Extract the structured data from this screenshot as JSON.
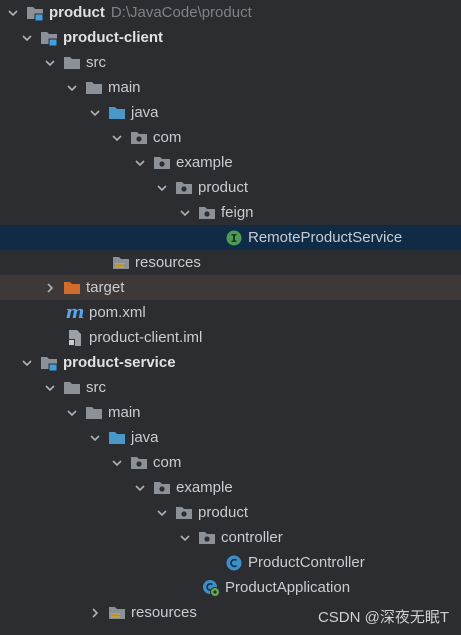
{
  "project": {
    "name": "product",
    "path": "D:\\JavaCode\\product"
  },
  "client": {
    "name": "product-client",
    "src": "src",
    "main": "main",
    "java": "java",
    "com": "com",
    "example": "example",
    "product": "product",
    "feign": "feign",
    "interface_file": "RemoteProductService",
    "resources": "resources",
    "target": "target",
    "pom": "pom.xml",
    "iml": "product-client.iml"
  },
  "service": {
    "name": "product-service",
    "src": "src",
    "main": "main",
    "java": "java",
    "com": "com",
    "example": "example",
    "product": "product",
    "controller": "controller",
    "controller_class": "ProductController",
    "app_class": "ProductApplication",
    "resources": "resources"
  },
  "watermark": "CSDN @深夜无眠T",
  "colors": {
    "background": "#2b2d30",
    "selected_row": "#0f2b46",
    "excluded_row": "#3f3838",
    "folder": "#8c9197",
    "source_folder": "#4a97c9",
    "excluded_folder": "#d36b2b",
    "module_badge": "#3f9fe0",
    "interface_icon": "#4e9b56",
    "class_icon": "#3d8fc9"
  },
  "icons": [
    "chevron-down-icon",
    "chevron-right-icon",
    "module-folder-icon",
    "folder-icon",
    "package-icon",
    "source-folder-icon",
    "resources-folder-icon",
    "excluded-folder-icon",
    "maven-icon",
    "iml-file-icon",
    "interface-icon",
    "class-icon",
    "spring-boot-class-icon"
  ]
}
